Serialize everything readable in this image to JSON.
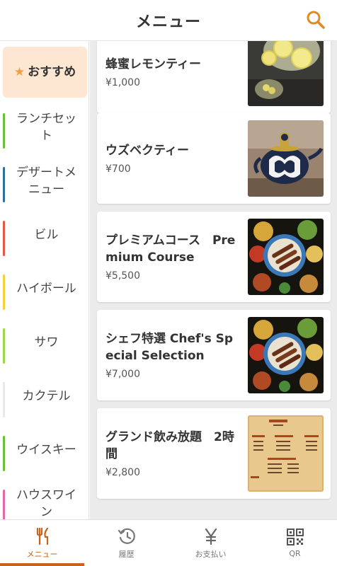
{
  "header": {
    "title": "メニュー"
  },
  "sidebar": {
    "items": [
      {
        "label": "おすすめ",
        "color": "#f0a047"
      },
      {
        "label": "ランチセット",
        "color": "#6cbf3a"
      },
      {
        "label": "デザートメニュー",
        "color": "#2f6fa0"
      },
      {
        "label": "ビル",
        "color": "#e05a4a"
      },
      {
        "label": "ハイボール",
        "color": "#f2d23c"
      },
      {
        "label": "サワ",
        "color": "#9dd64a"
      },
      {
        "label": "カクテル",
        "color": "#e8e8e8"
      },
      {
        "label": "ウイスキー",
        "color": "#6cbf3a"
      },
      {
        "label": "ハウスワイン",
        "color": "#e46aa7"
      }
    ]
  },
  "menu": {
    "items": [
      {
        "title": "蜂蜜レモンティー",
        "price": "¥1,000",
        "image": "lemon-tea"
      },
      {
        "title": "ウズベクティー",
        "price": "¥700",
        "image": "teapot"
      },
      {
        "title": "プレミアムコース　Premium Course",
        "price": "¥5,500",
        "image": "platter"
      },
      {
        "title": "シェフ特選 Chef's Special Selection",
        "price": "¥7,000",
        "image": "platter"
      },
      {
        "title": "グランド飲み放題　2時間",
        "price": "¥2,800",
        "image": "drink-menu"
      }
    ]
  },
  "tabs": [
    {
      "label": "メニュー",
      "icon": "fork-knife-icon",
      "active": true
    },
    {
      "label": "履歴",
      "icon": "history-icon",
      "active": false
    },
    {
      "label": "お支払い",
      "icon": "yen-icon",
      "active": false
    },
    {
      "label": "QR",
      "icon": "qr-code-icon",
      "active": false
    }
  ],
  "colors": {
    "accent": "#c8631d",
    "highlight": "#fde6d2",
    "star": "#f0a047"
  }
}
